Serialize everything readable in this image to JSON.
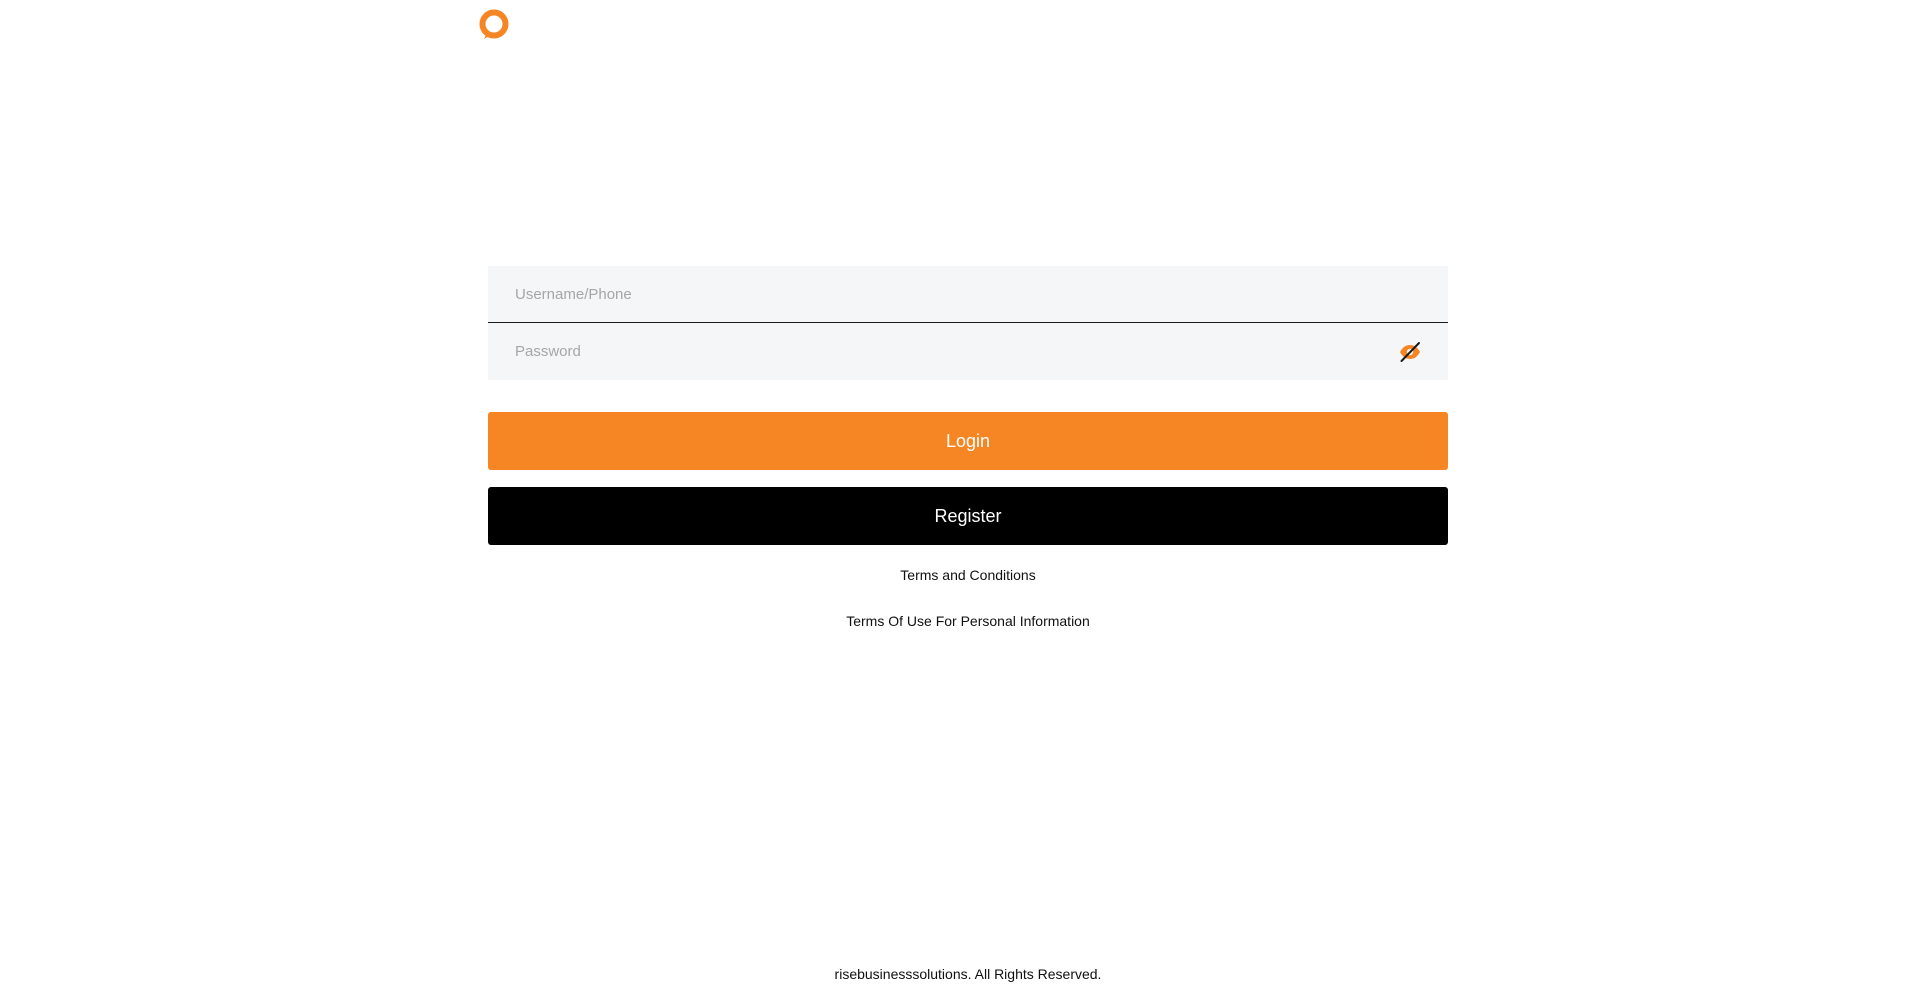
{
  "brand": {
    "logo_icon": "brand-logo-ring-icon",
    "accent_color": "#f68524"
  },
  "login_form": {
    "username_placeholder": "Username/Phone",
    "password_placeholder": "Password",
    "password_toggle_icon": "eye-slash-icon",
    "login_label": "Login",
    "register_label": "Register"
  },
  "links": {
    "terms": "Terms and Conditions",
    "personal_info": "Terms Of Use For Personal Information"
  },
  "footer": {
    "copyright": "risebusinesssolutions. All Rights Reserved."
  }
}
